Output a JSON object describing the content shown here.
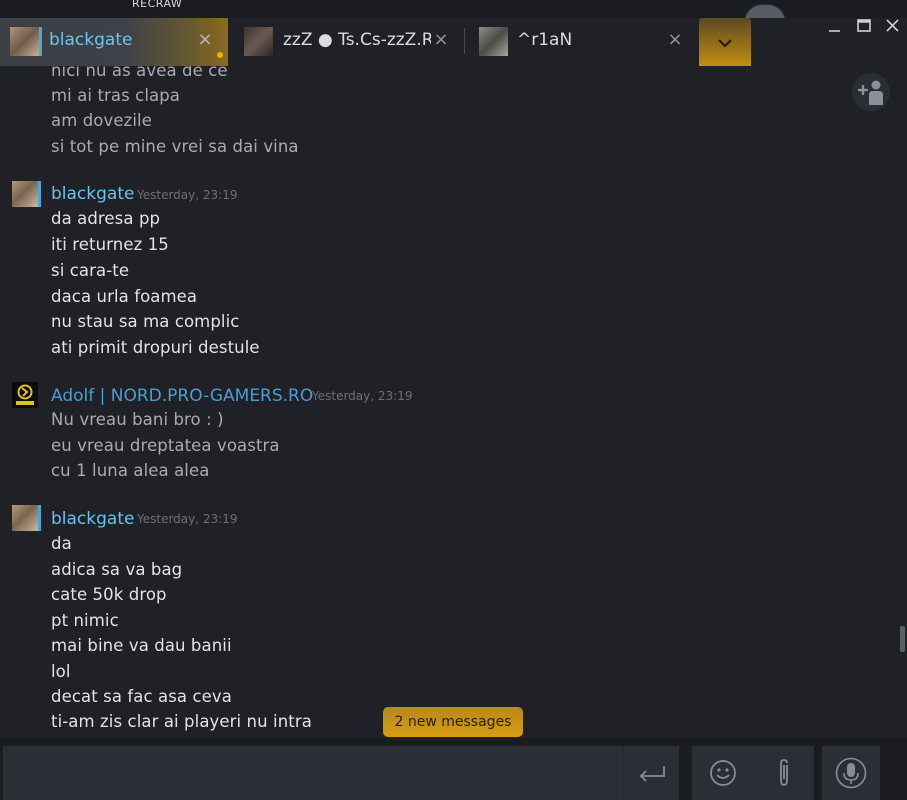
{
  "background": {
    "text": "RECRAW"
  },
  "tabs": [
    {
      "label": "blackgate",
      "active": true,
      "unread": true
    },
    {
      "label": "zzZ ● Ts.Cs-zzZ.Ro",
      "active": false
    },
    {
      "label": "^r1aN",
      "active": false
    }
  ],
  "tab_close_glyph": "×",
  "window_controls": {
    "minimize": "minimize-icon",
    "maximize": "maximize-icon",
    "close": "close-icon"
  },
  "chat": {
    "groups": [
      {
        "author": "",
        "timestamp": "",
        "lines": [
          "nici nu as avea de ce",
          "mi ai tras clapa",
          "am dovezile",
          "si tot pe mine vrei sa dai vina"
        ]
      },
      {
        "author": "blackgate",
        "timestamp": "Yesterday, 23:19",
        "lines": [
          "da adresa pp",
          "iti returnez 15",
          "si cara-te",
          "daca urla foamea",
          "nu stau sa ma complic",
          "ati primit dropuri destule"
        ]
      },
      {
        "author": "Adolf | NORD.PRO-GAMERS.RO",
        "timestamp": "Yesterday, 23:19",
        "lines": [
          "Nu vreau bani bro : )",
          "eu vreau dreptatea voastra",
          "cu 1 luna alea alea"
        ]
      },
      {
        "author": "blackgate",
        "timestamp": "Yesterday, 23:19",
        "lines": [
          "da",
          "adica sa va bag",
          "cate 50k drop",
          "pt nimic",
          "mai bine va dau banii",
          "lol",
          "decat sa fac asa ceva",
          "ti-am zis clar ai playeri nu intra"
        ]
      }
    ],
    "new_messages_label": "2 new messages"
  },
  "input": {
    "value": "",
    "placeholder": ""
  },
  "colors": {
    "accent": "#f0b400",
    "author": "#69c2ef",
    "background": "#1f2126",
    "input": "#2b2e34"
  },
  "icons": [
    "add-friend-icon",
    "chevron-down-icon",
    "send-enter-icon",
    "emoji-icon",
    "paperclip-icon",
    "microphone-icon"
  ]
}
